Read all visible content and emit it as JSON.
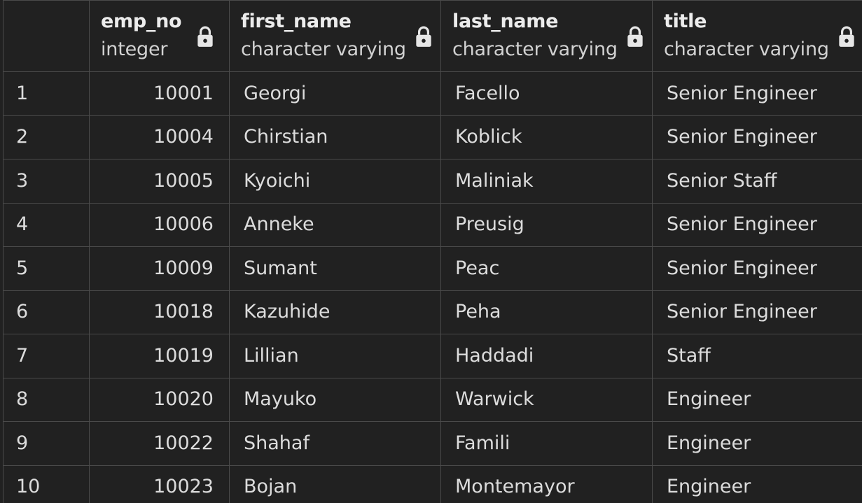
{
  "columns": [
    {
      "name": "",
      "type": ""
    },
    {
      "name": "emp_no",
      "type": "integer",
      "lock_icon": "lock-icon"
    },
    {
      "name": "first_name",
      "type": "character varying",
      "lock_icon": "lock-icon"
    },
    {
      "name": "last_name",
      "type": "character varying",
      "lock_icon": "lock-icon"
    },
    {
      "name": "title",
      "type": "character varying",
      "lock_icon": "lock-icon"
    }
  ],
  "rows": [
    {
      "idx": "1",
      "emp_no": "10001",
      "first_name": "Georgi",
      "last_name": "Facello",
      "title": "Senior Engineer"
    },
    {
      "idx": "2",
      "emp_no": "10004",
      "first_name": "Chirstian",
      "last_name": "Koblick",
      "title": "Senior Engineer"
    },
    {
      "idx": "3",
      "emp_no": "10005",
      "first_name": "Kyoichi",
      "last_name": "Maliniak",
      "title": "Senior Staff"
    },
    {
      "idx": "4",
      "emp_no": "10006",
      "first_name": "Anneke",
      "last_name": "Preusig",
      "title": "Senior Engineer"
    },
    {
      "idx": "5",
      "emp_no": "10009",
      "first_name": "Sumant",
      "last_name": "Peac",
      "title": "Senior Engineer"
    },
    {
      "idx": "6",
      "emp_no": "10018",
      "first_name": "Kazuhide",
      "last_name": "Peha",
      "title": "Senior Engineer"
    },
    {
      "idx": "7",
      "emp_no": "10019",
      "first_name": "Lillian",
      "last_name": "Haddadi",
      "title": "Staff"
    },
    {
      "idx": "8",
      "emp_no": "10020",
      "first_name": "Mayuko",
      "last_name": "Warwick",
      "title": "Engineer"
    },
    {
      "idx": "9",
      "emp_no": "10022",
      "first_name": "Shahaf",
      "last_name": "Famili",
      "title": "Engineer"
    },
    {
      "idx": "10",
      "emp_no": "10023",
      "first_name": "Bojan",
      "last_name": "Montemayor",
      "title": "Engineer"
    }
  ],
  "colors": {
    "background": "#212121",
    "grid_line": "#4a4a4a",
    "text": "#dcdcdc",
    "header_text": "#ececec"
  }
}
